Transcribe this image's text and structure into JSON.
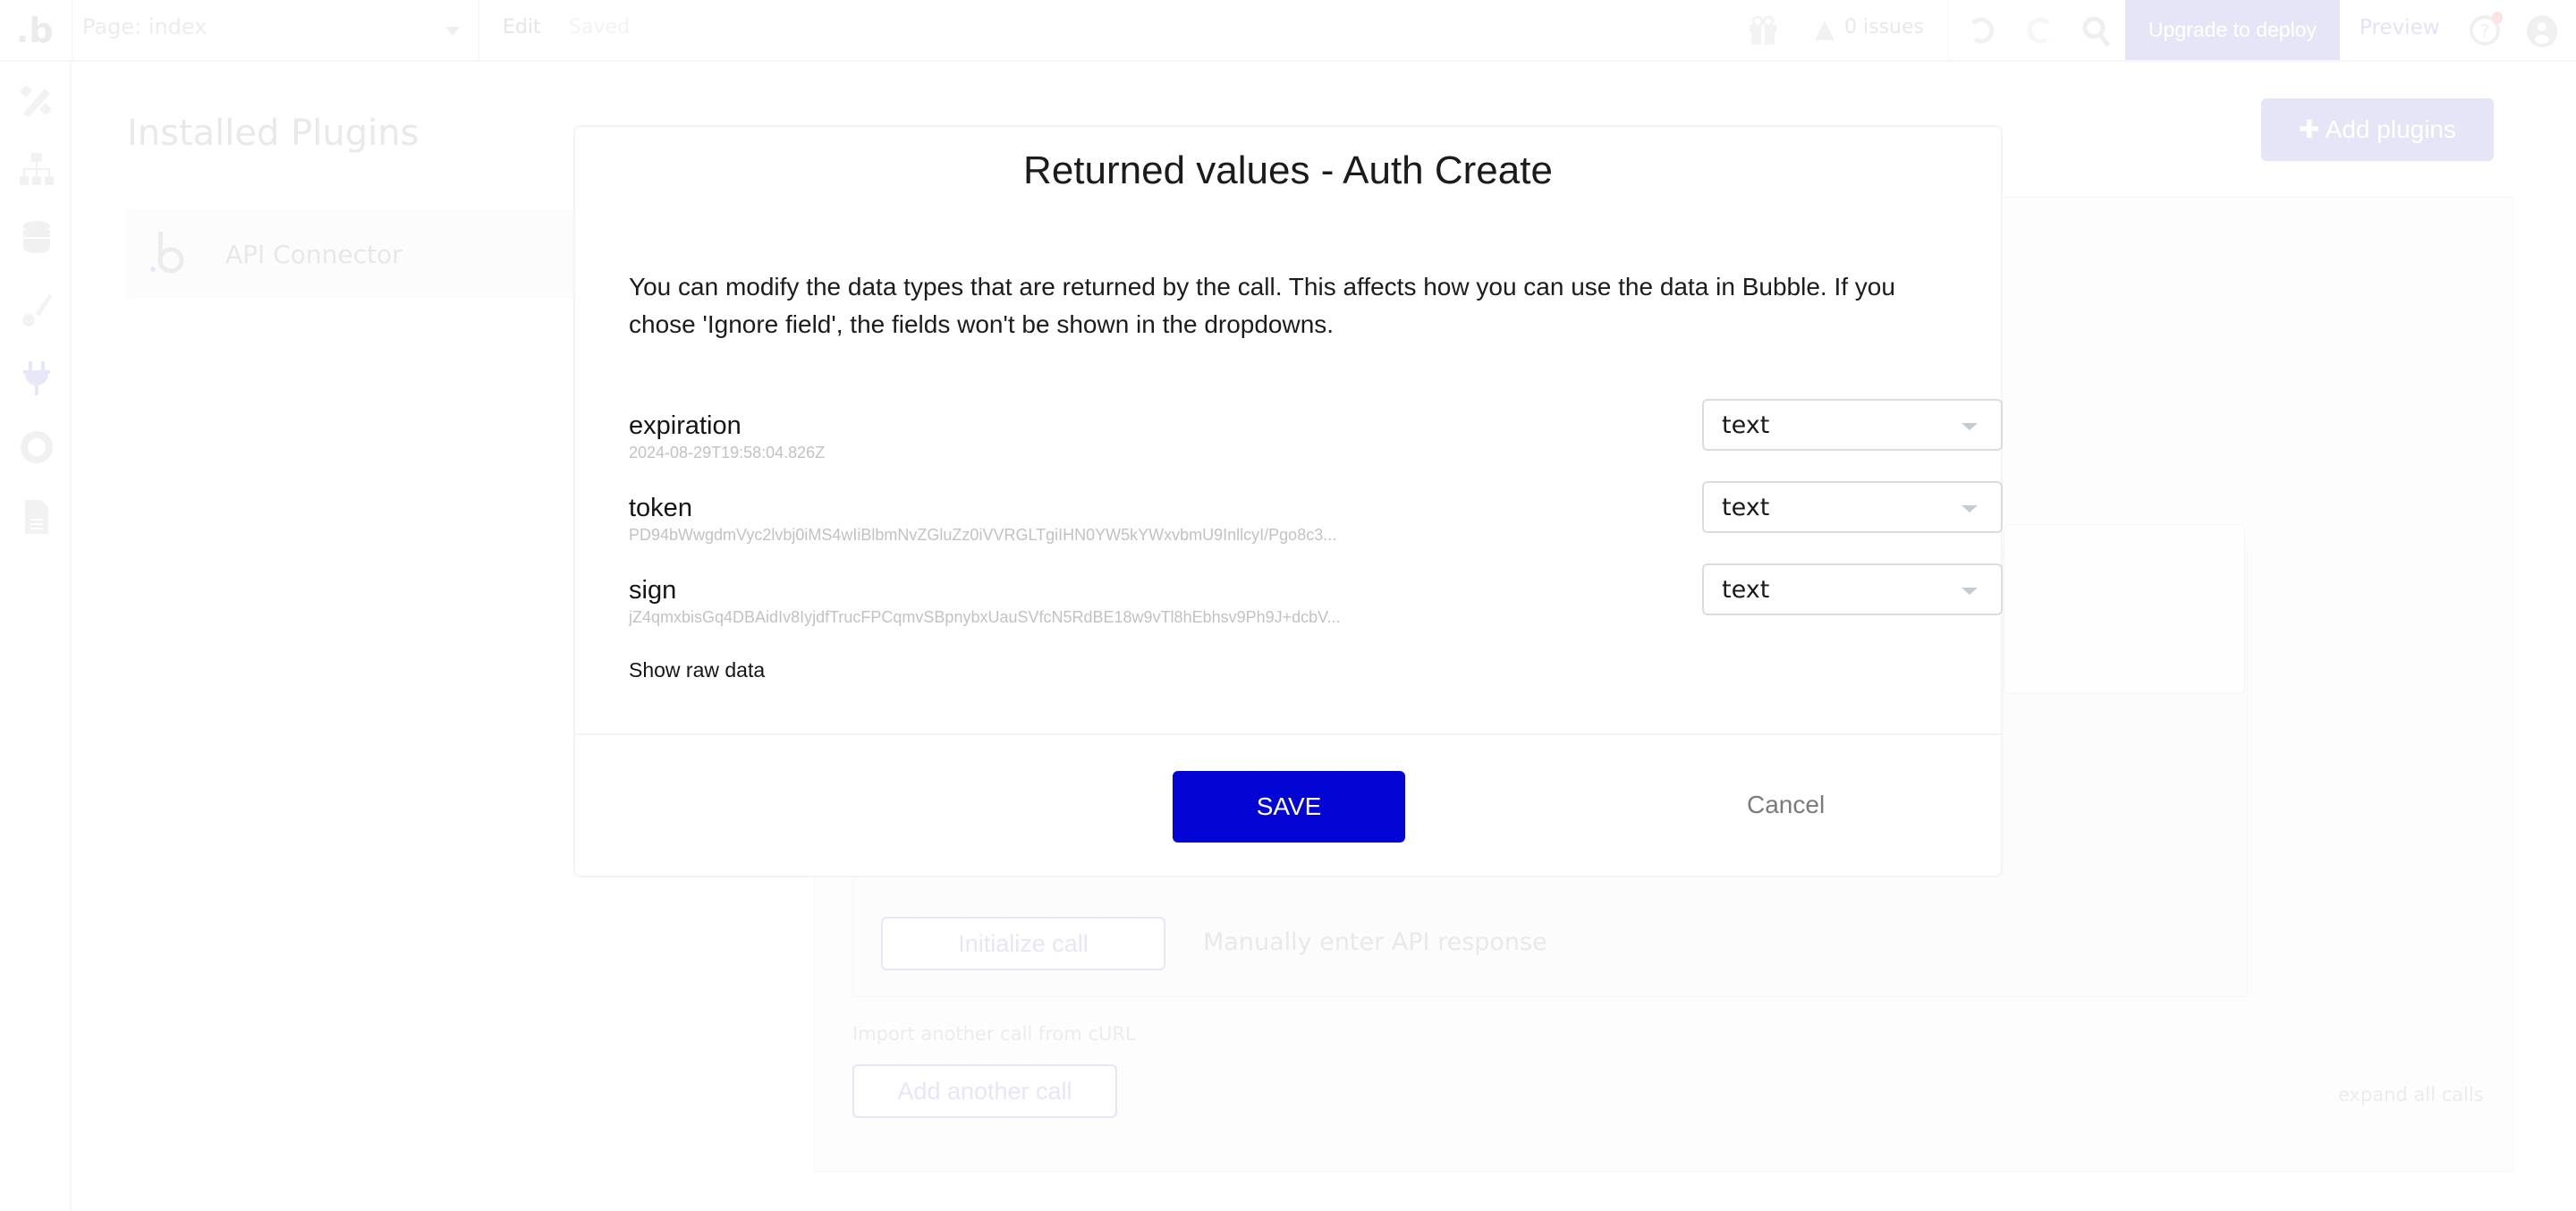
{
  "topbar": {
    "logo": ".b",
    "page_selector": "Page: index",
    "edit_label": "Edit",
    "saved_label": "Saved",
    "issues_label": "0 issues",
    "upgrade_label": "Upgrade to deploy",
    "preview_label": "Preview",
    "icons": [
      "gift-icon",
      "warning-icon",
      "undo-icon",
      "redo-icon",
      "search-icon",
      "help-icon",
      "user-icon"
    ]
  },
  "sidebar": {
    "items": [
      {
        "name": "design",
        "icon": "design-tools-icon"
      },
      {
        "name": "workflow",
        "icon": "sitemap-icon"
      },
      {
        "name": "data",
        "icon": "database-icon"
      },
      {
        "name": "styles",
        "icon": "brush-icon"
      },
      {
        "name": "plugins",
        "icon": "plug-icon",
        "active": true
      },
      {
        "name": "settings",
        "icon": "gear-icon"
      },
      {
        "name": "logs",
        "icon": "document-icon"
      }
    ]
  },
  "background": {
    "title": "Installed Plugins",
    "plugins": [
      {
        "name": "API Connector"
      }
    ],
    "add_plugins_label": "Add plugins",
    "initialize_call_label": "Initialize call",
    "manual_response_label": "Manually enter API response",
    "import_curl_label": "Import another call from cURL",
    "add_call_label": "Add another call",
    "expand_all_label": "expand all calls"
  },
  "dialog": {
    "title": "Returned values - Auth Create",
    "description": "You can modify the data types that are returned by the call. This affects how you can use the data in Bubble. If you chose 'Ignore field', the fields won't be shown in the dropdowns.",
    "fields": [
      {
        "name": "expiration",
        "sample": "2024-08-29T19:58:04.826Z",
        "type": "text"
      },
      {
        "name": "token",
        "sample": "PD94bWwgdmVyc2lvbj0iMS4wIiBlbmNvZGluZz0iVVRGLTgiIHN0YW5kYWxvbmU9InllcyI/Pgo8c3...",
        "type": "text"
      },
      {
        "name": "sign",
        "sample": "jZ4qmxbisGq4DBAidIv8IyjdfTrucFPCqmvSBpnybxUauSVfcN5RdBE18w9vTl8hEbhsv9Ph9J+dcbV...",
        "type": "text"
      }
    ],
    "show_raw_label": "Show raw data",
    "save_label": "SAVE",
    "cancel_label": "Cancel"
  },
  "colors": {
    "primary": "#0205d3",
    "upgrade_bg": "#e5e5f7",
    "cancel_text": "#7b7b7b"
  }
}
